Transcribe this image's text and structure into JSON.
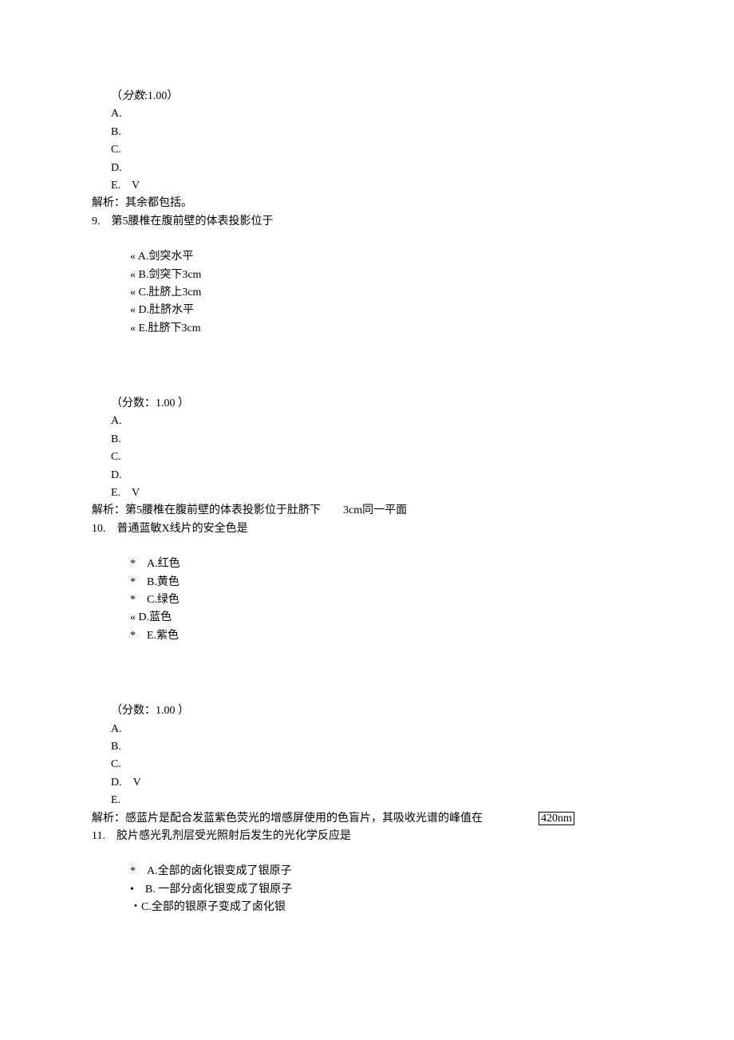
{
  "score1": {
    "label": "（",
    "word": "分数",
    "colon": ":1.00）"
  },
  "ans1": {
    "A": "A.",
    "B": "B.",
    "C": "C.",
    "D": "D.",
    "E": "E.　V"
  },
  "explain1": "解析：其余都包括。",
  "q9": {
    "num": "9.",
    "text": "第5腰椎在腹前壁的体表投影位于"
  },
  "q9opts": {
    "a": "« A.剑突水平",
    "b": "« B.剑突下3cm",
    "c": "« C.肚脐上3cm",
    "d": "« D.肚脐水平",
    "e": "« E.肚脐下3cm"
  },
  "score2": {
    "text": "（分数：1.00 ）"
  },
  "ans2": {
    "A": "A.",
    "B": "B.",
    "C": "C.",
    "D": "D.",
    "E": "E.　V"
  },
  "explain2_pre": "解析：第5腰椎在腹前壁的体表投影位于肚脐下",
  "explain2_post": "3cm同一平面",
  "q10": {
    "num": "10.",
    "text": "普通蓝敏X线片的安全色是"
  },
  "q10opts": {
    "a": "*　A.红色",
    "b": "*　B.黄色",
    "c": "*　C.绿色",
    "d": "« D.蓝色",
    "e": "*　E.紫色"
  },
  "score3": {
    "text": "（分数：1.00 ）"
  },
  "ans3": {
    "A": "A.",
    "B": "B.",
    "C": "C.",
    "D": "D.　V",
    "E": "E."
  },
  "explain3_pre": "解析：感蓝片是配合发蓝紫色荧光的增感屏使用的色盲片，其吸收光谱的峰值在",
  "explain3_box": "420nm",
  "q11": {
    "num": "11.",
    "text": "胶片感光乳剂层受光照射后发生的光化学反应是"
  },
  "q11opts": {
    "a": "*　A.全部的卤化银变成了银原子",
    "b": "•　B. 一部分卤化银变成了银原子",
    "c": "・C.全部的银原子变成了卤化银"
  }
}
